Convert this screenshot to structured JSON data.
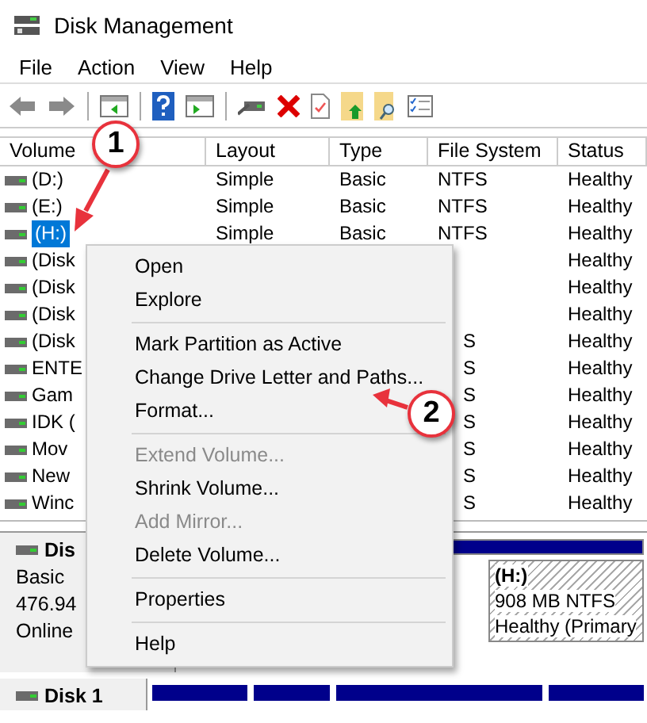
{
  "window": {
    "title": "Disk Management"
  },
  "menu_bar": [
    "File",
    "Action",
    "View",
    "Help"
  ],
  "table": {
    "columns": [
      "Volume",
      "Layout",
      "Type",
      "File System",
      "Status"
    ],
    "rows": [
      {
        "volume": "(D:)",
        "layout": "Simple",
        "type": "Basic",
        "file_system": "NTFS",
        "status": "Healthy",
        "selected": false
      },
      {
        "volume": "(E:)",
        "layout": "Simple",
        "type": "Basic",
        "file_system": "NTFS",
        "status": "Healthy",
        "selected": false
      },
      {
        "volume": "(H:)",
        "layout": "Simple",
        "type": "Basic",
        "file_system": "NTFS",
        "status": "Healthy",
        "selected": true
      },
      {
        "volume": "(Disk",
        "status": "Healthy",
        "selected": false
      },
      {
        "volume": "(Disk",
        "status": "Healthy",
        "selected": false
      },
      {
        "volume": "(Disk",
        "status": "Healthy",
        "selected": false
      },
      {
        "volume": "(Disk",
        "file_system": "S",
        "status": "Healthy",
        "selected": false
      },
      {
        "volume": "ENTE",
        "file_system": "S",
        "status": "Healthy",
        "selected": false
      },
      {
        "volume": "Gam",
        "file_system": "S",
        "status": "Healthy",
        "selected": false
      },
      {
        "volume": "IDK (",
        "file_system": "S",
        "status": "Healthy",
        "selected": false
      },
      {
        "volume": "Mov",
        "file_system": "S",
        "status": "Healthy",
        "selected": false
      },
      {
        "volume": "New",
        "file_system": "S",
        "status": "Healthy",
        "selected": false
      },
      {
        "volume": "Winc",
        "file_system": "S",
        "status": "Healthy",
        "selected": false
      }
    ]
  },
  "context_menu": {
    "items": [
      {
        "kind": "item",
        "label": "Open",
        "disabled": false
      },
      {
        "kind": "item",
        "label": "Explore",
        "disabled": false
      },
      {
        "kind": "separator"
      },
      {
        "kind": "item",
        "label": "Mark Partition as Active",
        "disabled": false
      },
      {
        "kind": "item",
        "label": "Change Drive Letter and Paths...",
        "disabled": false
      },
      {
        "kind": "item",
        "label": "Format...",
        "disabled": false
      },
      {
        "kind": "separator"
      },
      {
        "kind": "item",
        "label": "Extend Volume...",
        "disabled": true
      },
      {
        "kind": "item",
        "label": "Shrink Volume...",
        "disabled": false
      },
      {
        "kind": "item",
        "label": "Add Mirror...",
        "disabled": true
      },
      {
        "kind": "item",
        "label": "Delete Volume...",
        "disabled": false
      },
      {
        "kind": "separator"
      },
      {
        "kind": "item",
        "label": "Properties",
        "disabled": false
      },
      {
        "kind": "separator"
      },
      {
        "kind": "item",
        "label": "Help",
        "disabled": false
      }
    ]
  },
  "disk_pane": {
    "disks": [
      {
        "name": "Dis",
        "type": "Basic",
        "size": "476.94",
        "status": "Online",
        "partitions": [
          {
            "name": "(H:)",
            "detail": "908 MB NTFS",
            "status": "Healthy (Primary",
            "selected": true
          }
        ]
      },
      {
        "name": "Disk 1"
      }
    ]
  },
  "annotations": [
    {
      "label": "1"
    },
    {
      "label": "2"
    }
  ]
}
